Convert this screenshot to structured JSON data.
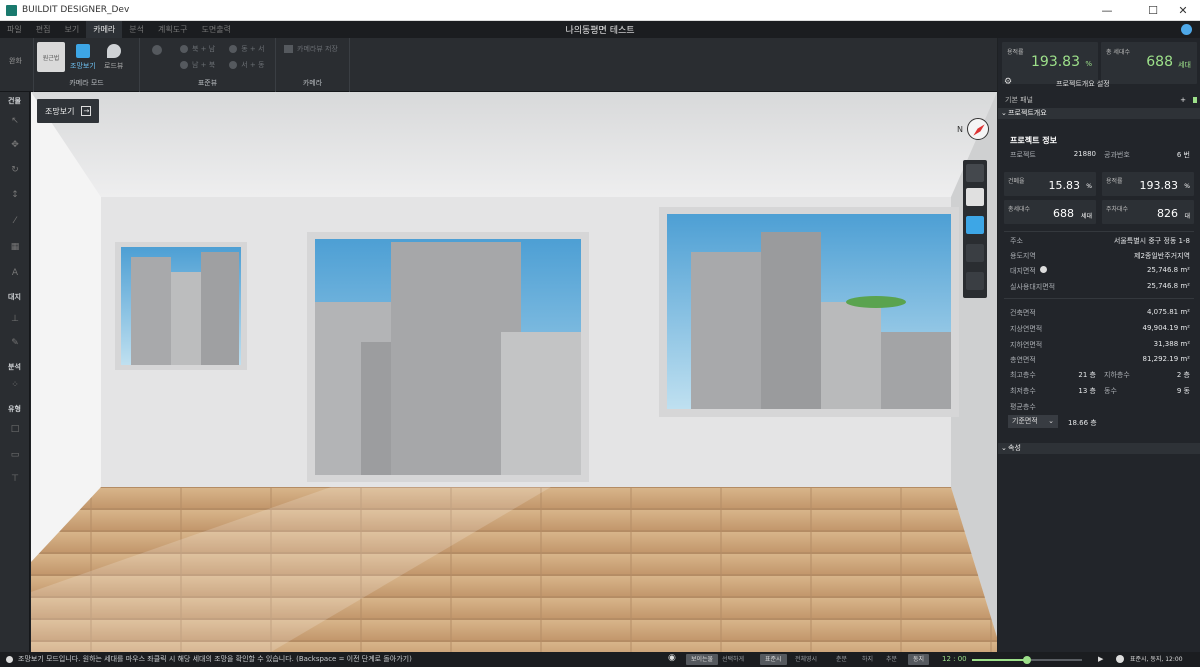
{
  "window": {
    "app_title": "BUILDIT DESIGNER_Dev",
    "minimize": "—",
    "maximize": "☐",
    "close": "✕"
  },
  "menubar": {
    "items": [
      "파일",
      "편집",
      "보기",
      "카메라",
      "분석",
      "계획도구",
      "도면출력"
    ],
    "active_index": 3,
    "doc_title": "나의동평면 테스트"
  },
  "ribbon": {
    "left_label": "완화",
    "sel_btn_label": "원근법",
    "camera_mode_buttons": [
      "조망보기",
      "로드뷰"
    ],
    "camera_mode_group": "카메라 모드",
    "standard_group": "표준뷰",
    "camera_group": "카메라",
    "std_items": [
      "북 + 남",
      "동 + 서",
      "남 + 북",
      "서 + 동"
    ],
    "camera_item": "카메라뷰 저장"
  },
  "left_toolbar": {
    "sections": [
      "건물",
      "대지",
      "분석",
      "유형"
    ]
  },
  "viewport": {
    "view_button": "조망보기",
    "compass_label": "N"
  },
  "right_panel": {
    "top_stats": [
      {
        "label": "용적률",
        "value": "193.83",
        "unit": "%"
      },
      {
        "label": "총 세대수",
        "value": "688",
        "unit": "세대"
      }
    ],
    "settings_label": "프로젝트개요 설정",
    "panel_header": "기본 패널",
    "section_overview": "프로젝트개요",
    "section_attr": "속성",
    "info_title": "프로젝트 정보",
    "project_no_label": "프로젝트",
    "project_no": "21880",
    "plan_no_label": "공과번호",
    "plan_no": "6 번",
    "cards": [
      {
        "label": "건폐율",
        "value": "15.83",
        "unit": "%"
      },
      {
        "label": "용적률",
        "value": "193.83",
        "unit": "%"
      },
      {
        "label": "총세대수",
        "value": "688",
        "unit": "세대"
      },
      {
        "label": "주차대수",
        "value": "826",
        "unit": "대"
      }
    ],
    "site_rows": [
      {
        "k": "주소",
        "v": "서울특별시 중구 정동 1-8"
      },
      {
        "k": "용도지역",
        "v": "제2종일반주거지역"
      },
      {
        "k": "대지면적",
        "v": "25,746.8 m²"
      },
      {
        "k": "실사용대지면적",
        "v": "25,746.8 m²"
      }
    ],
    "area_rows": [
      {
        "k": "건축면적",
        "v": "4,075.81 m²"
      },
      {
        "k": "지상연면적",
        "v": "49,904.19 m²"
      },
      {
        "k": "지하연면적",
        "v": "31,388 m²"
      },
      {
        "k": "총연면적",
        "v": "81,292.19 m²"
      }
    ],
    "floor_rows": [
      {
        "k": "최고층수",
        "v": "21 층",
        "k2": "지하층수",
        "v2": "2 층"
      },
      {
        "k": "최저층수",
        "v": "13 층",
        "k2": "동수",
        "v2": "9 동"
      }
    ],
    "avg_floor_label": "평균층수",
    "avg_select": "기준면적",
    "avg_value": "18.66 층"
  },
  "statusbar": {
    "message": "조망보기 모드입니다. 원하는 세대를 마우스 좌클릭 시 해당 세대의 조망을 확인할 수 있습니다. (Backspace = 이전 단계로 돌아가기)",
    "pills": [
      "보이는물",
      "선택하게",
      "표준시",
      "전체영시"
    ],
    "time_labels": [
      "춘분",
      "하지",
      "추분",
      "동지"
    ],
    "time_value": "12 : 00",
    "time_summary": "표준시, 동지, 12:00",
    "slider_fraction": 0.5
  }
}
